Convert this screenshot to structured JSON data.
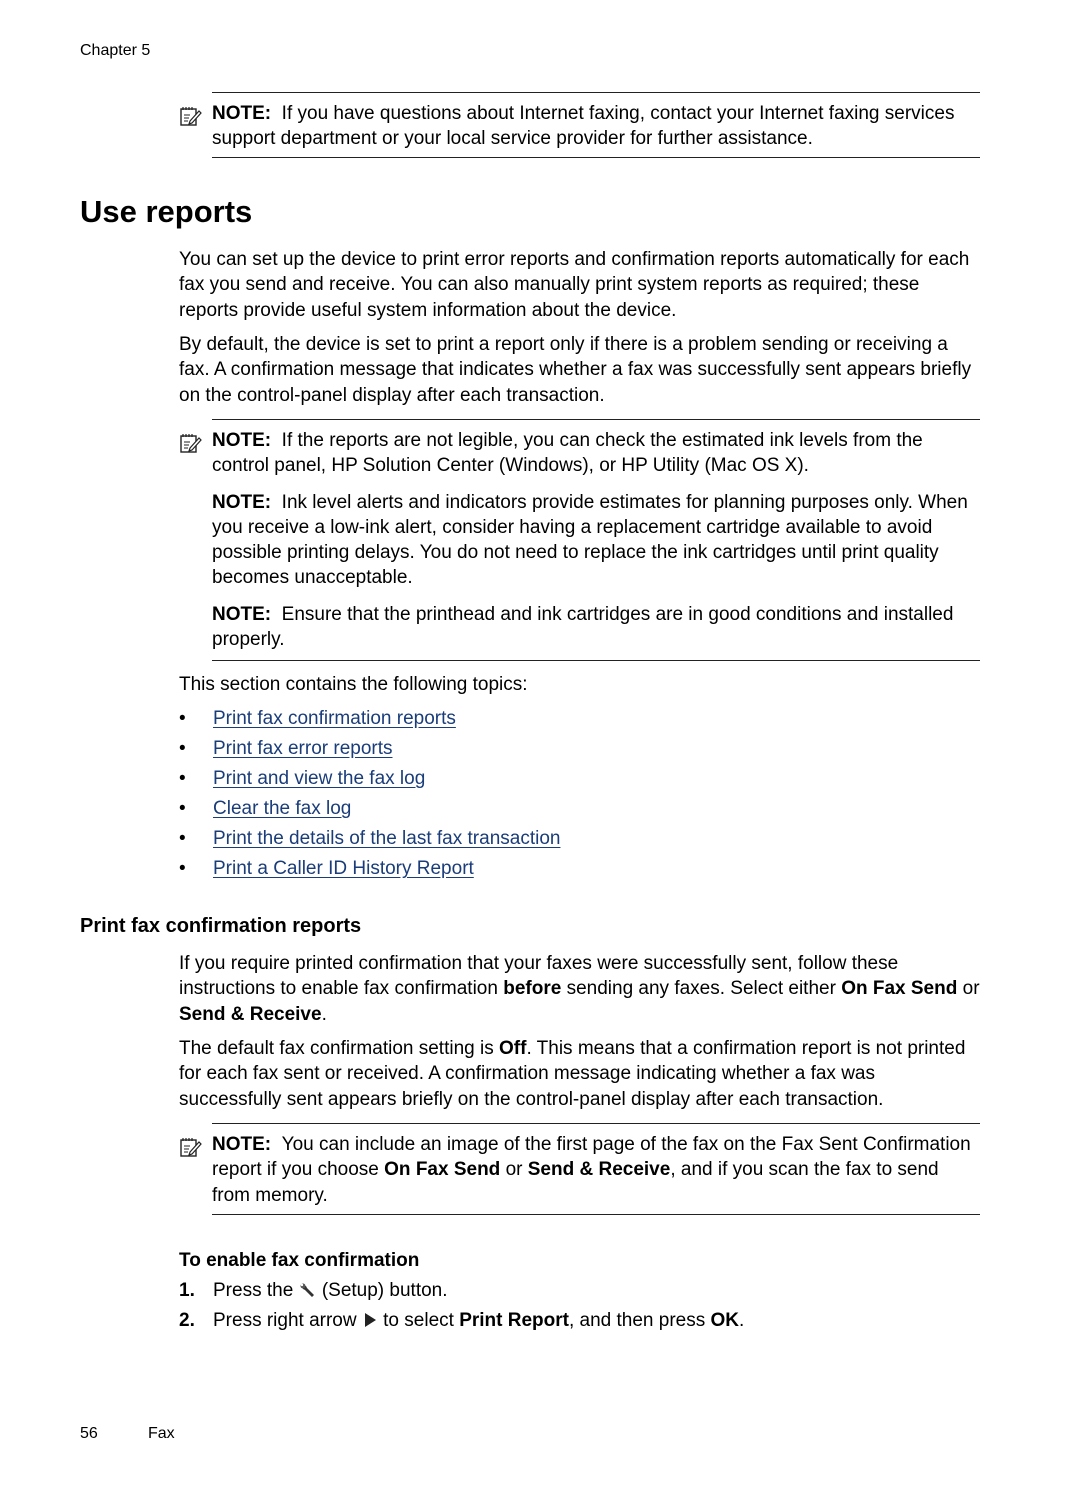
{
  "header": {
    "running_head": "Chapter 5"
  },
  "note_internet": {
    "label": "NOTE:",
    "text": "If you have questions about Internet faxing, contact your Internet faxing services support department or your local service provider for further assistance."
  },
  "section": {
    "title": "Use reports",
    "intro_1": "You can set up the device to print error reports and confirmation reports automatically for each fax you send and receive. You can also manually print system reports as required; these reports provide useful system information about the device.",
    "intro_2": "By default, the device is set to print a report only if there is a problem sending or receiving a fax. A confirmation message that indicates whether a fax was successfully sent appears briefly on the control-panel display after each transaction."
  },
  "notes_block": [
    {
      "label": "NOTE:",
      "text": "If the reports are not legible, you can check the estimated ink levels from the control panel, HP Solution Center (Windows), or HP Utility (Mac OS X)."
    },
    {
      "label": "NOTE:",
      "text": "Ink level alerts and indicators provide estimates for planning purposes only. When you receive a low-ink alert, consider having a replacement cartridge available to avoid possible printing delays. You do not need to replace the ink cartridges until print quality becomes unacceptable."
    },
    {
      "label": "NOTE:",
      "text": "Ensure that the printhead and ink cartridges are in good conditions and installed properly."
    }
  ],
  "topics": {
    "intro": "This section contains the following topics:",
    "bullet": "•",
    "link_color": "#1a3d7a",
    "items": [
      "Print fax confirmation reports",
      "Print fax error reports",
      "Print and view the fax log",
      "Clear the fax log",
      "Print the details of the last fax transaction",
      "Print a Caller ID History Report"
    ]
  },
  "subsection": {
    "title": "Print fax confirmation reports",
    "p1": {
      "a": "If you require printed confirmation that your faxes were successfully sent, follow these instructions to enable fax confirmation ",
      "b1": "before",
      "c": " sending any faxes. Select either ",
      "b2": "On Fax Send",
      "d": " or ",
      "b3": "Send & Receive",
      "e": "."
    },
    "p2": {
      "a": "The default fax confirmation setting is ",
      "b1": "Off",
      "c": ". This means that a confirmation report is not printed for each fax sent or received. A confirmation message indicating whether a fax was successfully sent appears briefly on the control-panel display after each transaction."
    },
    "note": {
      "label": "NOTE:",
      "a": "You can include an image of the first page of the fax on the Fax Sent Confirmation report if you choose ",
      "b1": "On Fax Send",
      "c": " or ",
      "b2": "Send & Receive",
      "d": ", and if you scan the fax to send from memory."
    }
  },
  "procedure": {
    "title": "To enable fax confirmation",
    "steps": [
      {
        "num": "1.",
        "a": "Press the ",
        "icon": "setup-wrench-icon",
        "b": " (Setup) button."
      },
      {
        "num": "2.",
        "a": "Press right arrow ",
        "icon": "right-arrow-icon",
        "b": " to select ",
        "bold1": "Print Report",
        "c": ", and then press ",
        "bold2": "OK",
        "d": "."
      }
    ]
  },
  "footer": {
    "page_number": "56",
    "section": "Fax"
  }
}
